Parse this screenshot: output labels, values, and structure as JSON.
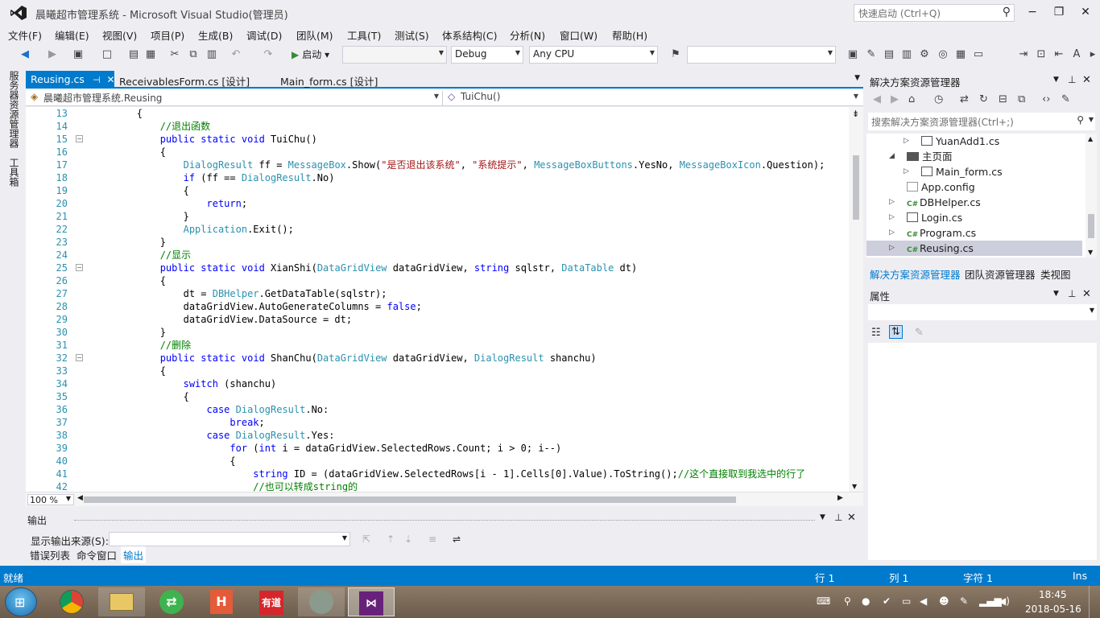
{
  "window": {
    "title": "晨曦超市管理系统 - Microsoft Visual Studio(管理员)",
    "quick_launch_placeholder": "快速启动 (Ctrl+Q)"
  },
  "menu": [
    "文件(F)",
    "编辑(E)",
    "视图(V)",
    "项目(P)",
    "生成(B)",
    "调试(D)",
    "团队(M)",
    "工具(T)",
    "测试(S)",
    "体系结构(C)",
    "分析(N)",
    "窗口(W)",
    "帮助(H)"
  ],
  "toolbar": {
    "start_label": "启动",
    "configuration": "Debug",
    "platform": "Any CPU"
  },
  "left_strip": [
    "服务器资源管理器",
    "工具箱"
  ],
  "doc_tabs": [
    {
      "label": "Reusing.cs",
      "active": true
    },
    {
      "label": "ReceivablesForm.cs [设计]",
      "active": false
    },
    {
      "label": "Main_form.cs [设计]",
      "active": false
    }
  ],
  "navbar": {
    "class_path": "晨曦超市管理系统.Reusing",
    "member": "TuiChu()"
  },
  "editor": {
    "zoom": "100 %",
    "line_numbers": [
      "13",
      "14",
      "15",
      "16",
      "17",
      "18",
      "19",
      "20",
      "21",
      "22",
      "23",
      "24",
      "25",
      "26",
      "27",
      "28",
      "29",
      "30",
      "31",
      "32",
      "33",
      "34",
      "35",
      "36",
      "37",
      "38",
      "39",
      "40",
      "41",
      "42"
    ],
    "code_lines": [
      "        {",
      "            //退出函数",
      "            public static void TuiChu()",
      "            {",
      "                DialogResult ff = MessageBox.Show(\"是否退出该系统\", \"系统提示\", MessageBoxButtons.YesNo, MessageBoxIcon.Question);",
      "                if (ff == DialogResult.No)",
      "                {",
      "                    return;",
      "                }",
      "                Application.Exit();",
      "            }",
      "            //显示",
      "            public static void XianShi(DataGridView dataGridView, string sqlstr, DataTable dt)",
      "            {",
      "                dt = DBHelper.GetDataTable(sqlstr);",
      "                dataGridView.AutoGenerateColumns = false;",
      "                dataGridView.DataSource = dt;",
      "            }",
      "            //删除",
      "            public static void ShanChu(DataGridView dataGridView, DialogResult shanchu)",
      "            {",
      "                switch (shanchu)",
      "                {",
      "                    case DialogResult.No:",
      "                        break;",
      "                    case DialogResult.Yes:",
      "                        for (int i = dataGridView.SelectedRows.Count; i > 0; i--)",
      "                        {",
      "                            string ID = (dataGridView.SelectedRows[i - 1].Cells[0].Value).ToString();//这个直接取到我选中的行了",
      "                            //也可以转成string的"
    ]
  },
  "output": {
    "title": "输出",
    "source_label": "显示输出来源(S):",
    "tabs": [
      "错误列表",
      "命令窗口",
      "输出"
    ]
  },
  "solution_explorer": {
    "title": "解决方案资源管理器",
    "search_placeholder": "搜索解决方案资源管理器(Ctrl+;)",
    "items": [
      "YuanAdd1.cs",
      "主页面",
      "Main_form.cs",
      "App.config",
      "DBHelper.cs",
      "Login.cs",
      "Program.cs",
      "Reusing.cs"
    ],
    "tabs": [
      "解决方案资源管理器",
      "团队资源管理器",
      "类视图"
    ]
  },
  "properties": {
    "title": "属性"
  },
  "statusbar": {
    "ready": "就绪",
    "line": "行 1",
    "col": "列 1",
    "char": "字符 1",
    "mode": "Ins"
  },
  "taskbar": {
    "time": "18:45",
    "date": "2018-05-16",
    "apps": [
      "H",
      "有道"
    ]
  },
  "colors": {
    "accent": "#007ACC",
    "keyword": "#0000FF",
    "type": "#2B91AF",
    "comment": "#008000",
    "string": "#A31515"
  }
}
